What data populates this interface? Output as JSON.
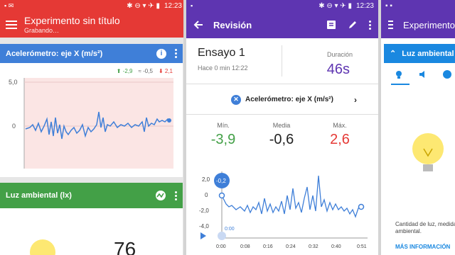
{
  "screens": {
    "experiment": {
      "status_time": "12:23",
      "title": "Experimento sin título",
      "subtitle": "Grabando…",
      "accel_card": {
        "title": "Acelerómetro: eje X (m/s²)",
        "stat_max": "-2,9",
        "stat_avg": "-0,5",
        "stat_min": "2,1",
        "y_ticks": [
          "5,0",
          "0"
        ]
      },
      "light_card": {
        "title": "Luz ambiental (lx)",
        "value": "76"
      }
    },
    "review": {
      "status_time": "12:23",
      "title": "Revisión",
      "run_name": "Ensayo 1",
      "run_time": "Hace 0 min 12:22",
      "duration_label": "Duración",
      "duration_value": "46s",
      "sensor_name": "Acelerómetro: eje X (m/s²)",
      "stats": [
        {
          "label": "Mín.",
          "value": "-3,9",
          "color": "#43a047"
        },
        {
          "label": "Media",
          "value": "-0,6",
          "color": "#222222"
        },
        {
          "label": "Máx.",
          "value": "2,6",
          "color": "#e53935"
        }
      ],
      "cursor_value": "-0,2",
      "cursor_time": "0:00",
      "y_ticks": [
        "2,0",
        "0",
        "-2,0",
        "-4,0"
      ],
      "x_ticks": [
        "0:00",
        "0:08",
        "0:16",
        "0:24",
        "0:32",
        "0:40",
        "0:51"
      ]
    },
    "third": {
      "title": "Experimento",
      "card_title": "Luz ambiental",
      "description": "Cantidad de luz, medida ambiental.",
      "more_link": "MÁS INFORMACIÓN"
    }
  },
  "colors": {
    "red": "#e53935",
    "purple": "#5e35b1",
    "blue": "#3f7fd8",
    "green": "#43a047"
  },
  "icons": [
    "menu-icon",
    "info-icon",
    "more-vert-icon",
    "back-arrow-icon",
    "notes-icon",
    "edit-icon",
    "play-icon",
    "chevron-right-icon",
    "lightbulb-icon",
    "volume-icon"
  ]
}
